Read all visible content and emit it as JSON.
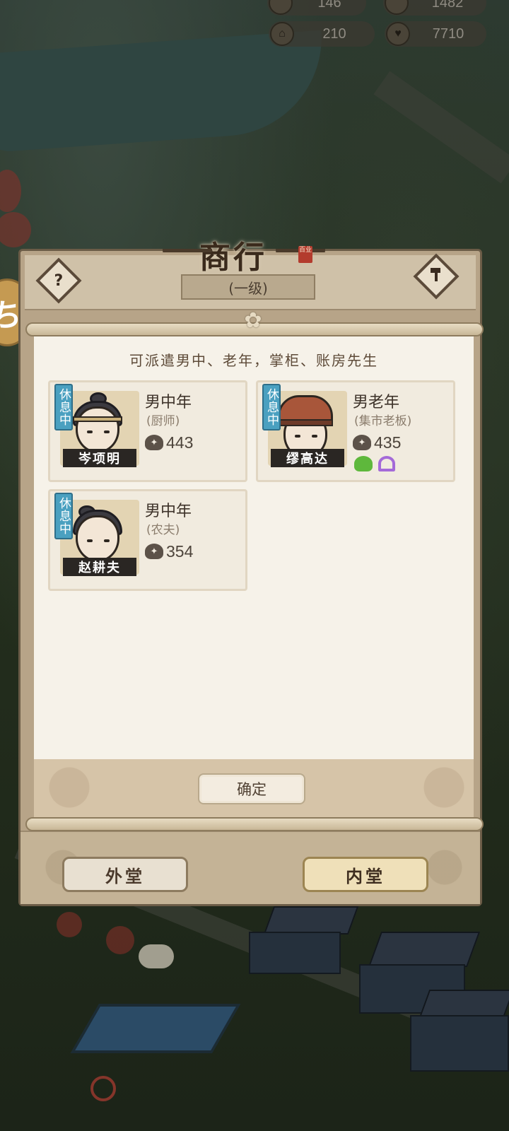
{
  "hud": {
    "top_left_value": "146",
    "top_right_value": "1482",
    "building_count": "210",
    "heart_count": "7710"
  },
  "modal": {
    "title": "商行",
    "title_seal": "百业",
    "level": "(一级)",
    "help_icon": "?",
    "hint": "可派遣男中、老年，掌柜、账房先生",
    "confirm_label": "确定",
    "tabs": {
      "outer": "外堂",
      "inner": "内堂"
    }
  },
  "workers": [
    {
      "name": "岑项明",
      "status": "休息中",
      "role": "男中年",
      "job": "(厨师)",
      "power": "443",
      "traits": []
    },
    {
      "name": "缪高达",
      "status": "休息中",
      "role": "男老年",
      "job": "(集市老板)",
      "power": "435",
      "traits": [
        "green-figure-icon",
        "purple-head-icon"
      ]
    },
    {
      "name": "赵耕夫",
      "status": "休息中",
      "role": "男中年",
      "job": "(农夫)",
      "power": "354",
      "traits": []
    }
  ],
  "colors": {
    "status_badge": "#4aa0c0",
    "paper": "#f6f2e9",
    "frame": "#b7a488"
  }
}
